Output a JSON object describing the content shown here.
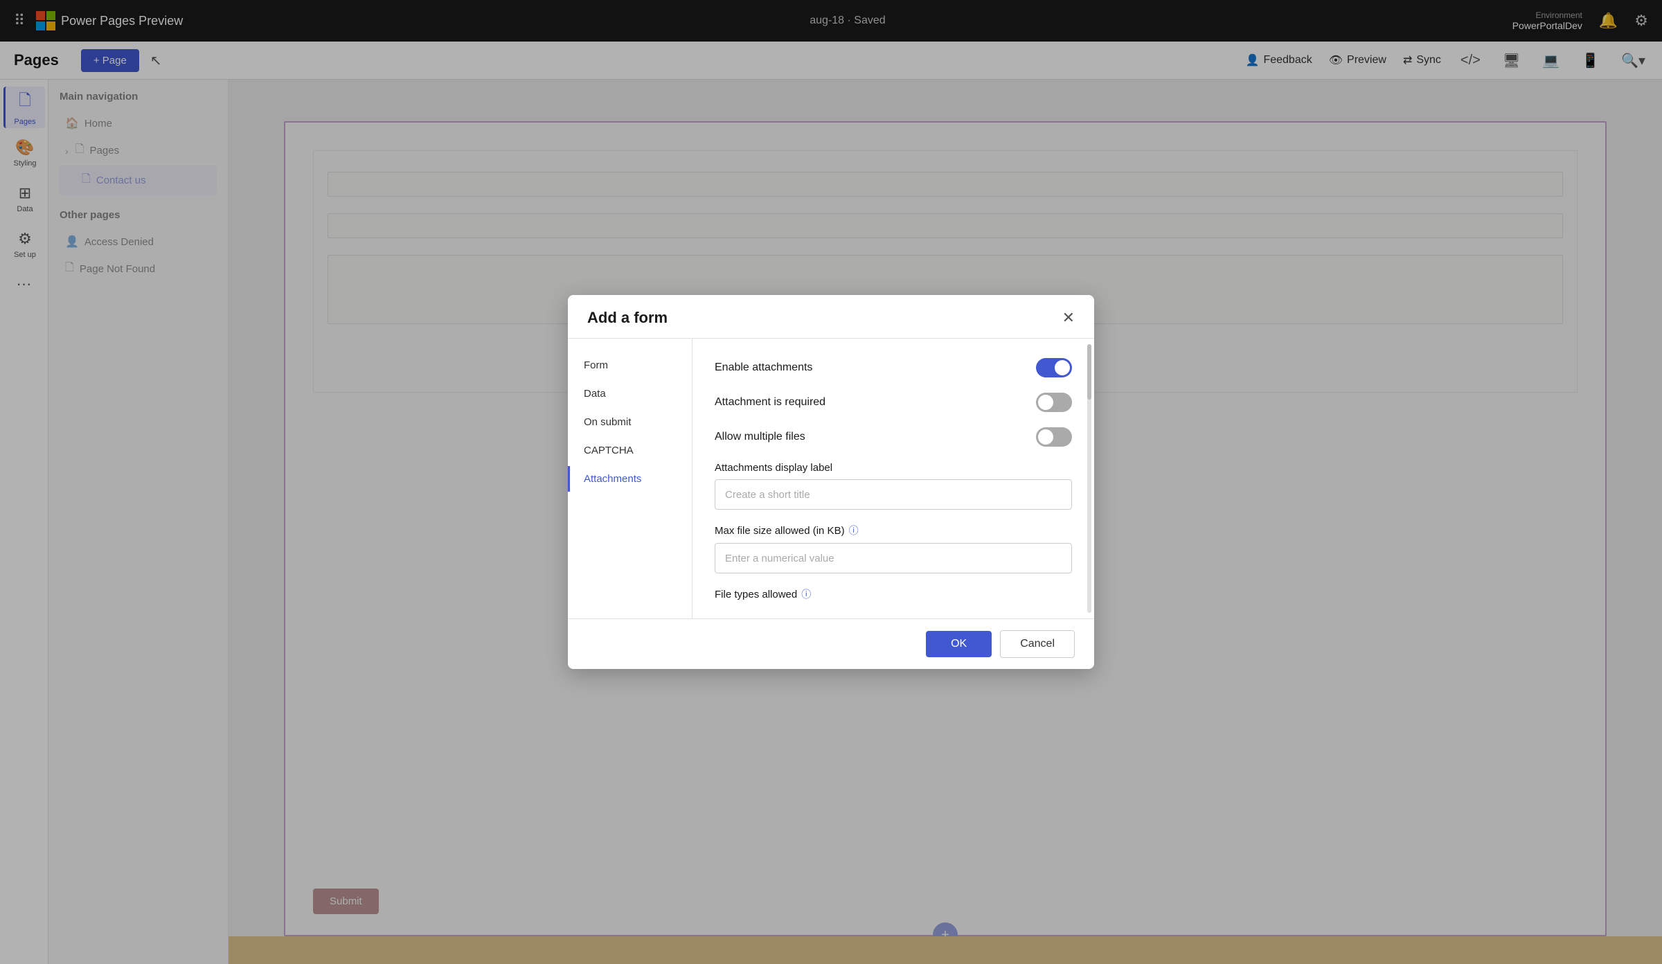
{
  "topbar": {
    "app_name": "Power Pages Preview",
    "saved_status": "aug-18 · Saved",
    "env_label": "Environment",
    "env_name": "PowerPortalDev",
    "feedback_label": "Feedback",
    "preview_label": "Preview",
    "sync_label": "Sync"
  },
  "secondary_nav": {
    "pages_title": "Pages",
    "add_page_label": "+ Page"
  },
  "sidebar": {
    "items": [
      {
        "id": "pages",
        "label": "Pages",
        "icon": "🗋",
        "active": true
      },
      {
        "id": "styling",
        "label": "Styling",
        "icon": "🎨",
        "active": false
      },
      {
        "id": "data",
        "label": "Data",
        "icon": "⊞",
        "active": false
      },
      {
        "id": "setup",
        "label": "Set up",
        "icon": "⚙",
        "active": false
      }
    ]
  },
  "pages_panel": {
    "main_nav_title": "Main navigation",
    "main_nav_items": [
      {
        "label": "Home",
        "icon": "🏠"
      },
      {
        "label": "Pages",
        "icon": "🗋",
        "chevron": true
      },
      {
        "label": "Contact us",
        "icon": "🗋",
        "active": true
      }
    ],
    "other_pages_title": "Other pages",
    "other_pages_items": [
      {
        "label": "Access Denied",
        "icon": "👤"
      },
      {
        "label": "Page Not Found",
        "icon": "🗋"
      }
    ]
  },
  "dialog": {
    "title": "Add a form",
    "close_icon": "✕",
    "nav_items": [
      {
        "id": "form",
        "label": "Form",
        "active": false
      },
      {
        "id": "data",
        "label": "Data",
        "active": false
      },
      {
        "id": "on_submit",
        "label": "On submit",
        "active": false
      },
      {
        "id": "captcha",
        "label": "CAPTCHA",
        "active": false
      },
      {
        "id": "attachments",
        "label": "Attachments",
        "active": true
      }
    ],
    "content": {
      "enable_attachments_label": "Enable attachments",
      "enable_attachments_on": true,
      "attachment_required_label": "Attachment is required",
      "attachment_required_on": false,
      "allow_multiple_label": "Allow multiple files",
      "allow_multiple_on": false,
      "display_label_title": "Attachments display label",
      "display_label_placeholder": "Create a short title",
      "max_file_size_label": "Max file size allowed (in KB)",
      "max_file_size_placeholder": "Enter a numerical value",
      "file_types_label": "File types allowed",
      "info_icon": "ⓘ"
    },
    "footer": {
      "ok_label": "OK",
      "cancel_label": "Cancel"
    }
  },
  "canvas": {
    "submit_label": "Submit",
    "plus_icon": "+"
  }
}
